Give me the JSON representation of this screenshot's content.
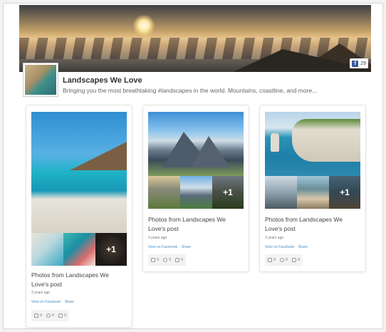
{
  "page": {
    "title": "Landscapes We Love",
    "description": "Bringing you the most breathtaking #landscapes in the world. Mountains, coastline, and more...",
    "like_count": "29"
  },
  "posts": [
    {
      "title": "Photos from Landscapes We Love's post",
      "time": "3 years ago",
      "view_link": "View on Facebook",
      "share_link": "Share",
      "likes": "0",
      "comments": "0",
      "shares": "0",
      "more_count": "+1"
    },
    {
      "title": "Photos from Landscapes We Love's post",
      "time": "3 years ago",
      "view_link": "View on Facebook",
      "share_link": "Share",
      "likes": "0",
      "comments": "0",
      "shares": "0",
      "more_count": "+1"
    },
    {
      "title": "Photos from Landscapes We Love's post",
      "time": "3 years ago",
      "view_link": "View on Facebook",
      "share_link": "Share",
      "likes": "0",
      "comments": "0",
      "shares": "0",
      "more_count": "+1"
    }
  ],
  "colors": {
    "link": "#4a8fc4",
    "facebook": "#3b5998"
  }
}
